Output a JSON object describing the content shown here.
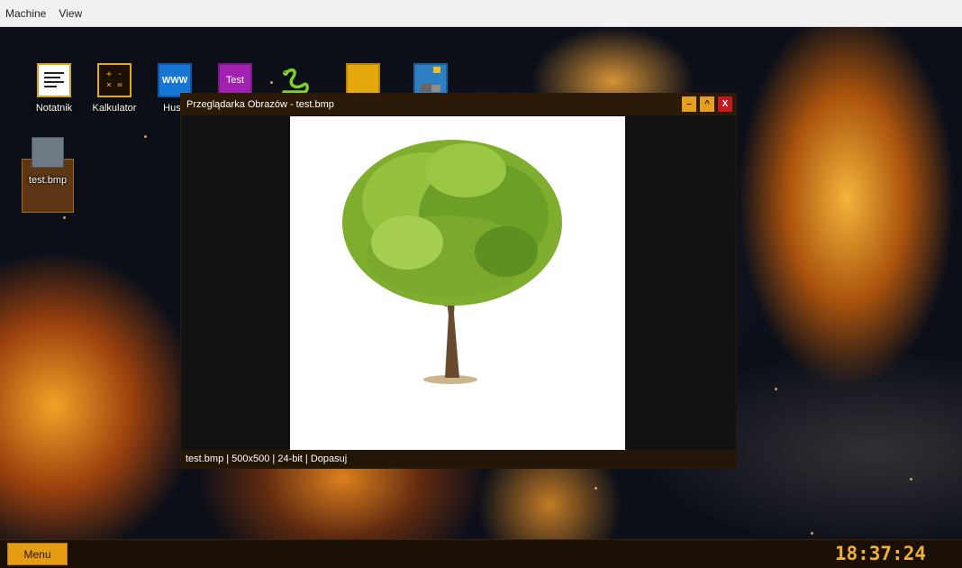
{
  "host_menubar": {
    "items": [
      "Machine",
      "View"
    ]
  },
  "desktop": {
    "icons": [
      {
        "label": "Notatnik",
        "icon": "notepad-icon"
      },
      {
        "label": "Kalkulator",
        "icon": "calculator-icon"
      },
      {
        "label": "Husa",
        "icon": "www-browser-icon",
        "glyph": "WWW"
      },
      {
        "label": "",
        "icon": "test-app-icon",
        "glyph": "Test"
      },
      {
        "label": "",
        "icon": "snake-icon"
      },
      {
        "label": "",
        "icon": "folder-icon"
      },
      {
        "label": "",
        "icon": "paint-icon"
      },
      {
        "label": "test.bmp",
        "icon": "bmp-file-icon"
      }
    ],
    "kalk_glyph_top": "+ -",
    "kalk_glyph_bottom": "× ="
  },
  "window": {
    "title": "Przeglądarka Obrazów - test.bmp",
    "buttons": {
      "minimize": "–",
      "maximize": "^",
      "close": "X"
    },
    "status": "test.bmp | 500x500 | 24-bit | Dopasuj",
    "image_subject": "tree"
  },
  "taskbar": {
    "menu_label": "Menu",
    "clock": "18:37:24"
  },
  "colors": {
    "accent": "#e69d16",
    "close": "#c5181c",
    "clock": "#f0b030"
  }
}
